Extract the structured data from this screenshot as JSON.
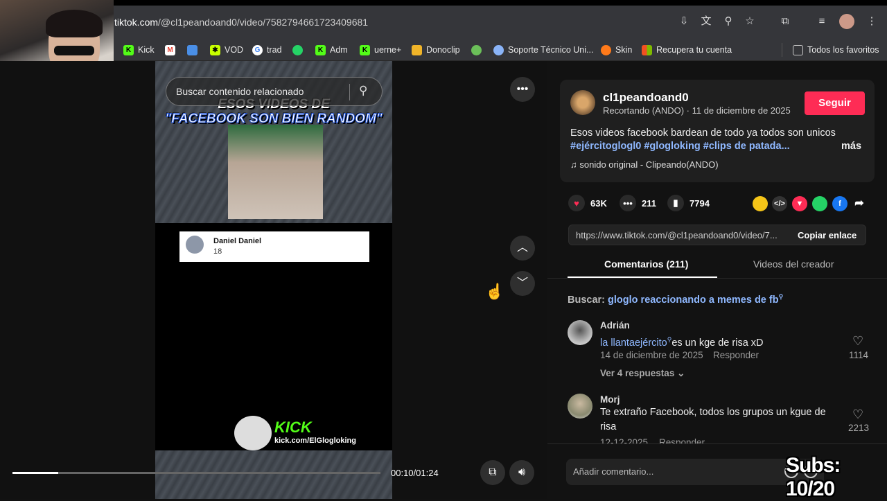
{
  "browser": {
    "url_host": "tiktok.com",
    "url_path": "/@cl1peandoand0/video/7582794661723409681",
    "bookmarks": [
      {
        "label": "Kick",
        "icon": "kick-icon",
        "color": "#53fc18"
      },
      {
        "label": "",
        "icon": "gmail-icon",
        "color": "#ea4335"
      },
      {
        "label": "",
        "icon": "extension-icon",
        "color": "#4a8fe7"
      },
      {
        "label": "VOD",
        "icon": "vod-icon",
        "color": "#c8ff00"
      },
      {
        "label": "trad",
        "icon": "google-icon",
        "color": "#ffffff"
      },
      {
        "label": "",
        "icon": "whatsapp-icon",
        "color": "#25d366"
      },
      {
        "label": "Adm",
        "icon": "kick-icon",
        "color": "#53fc18"
      },
      {
        "label": "uerne+",
        "icon": "kick-icon",
        "color": "#53fc18"
      },
      {
        "label": "Donoclip",
        "icon": "donoclip-icon",
        "color": "#f0b429"
      },
      {
        "label": "",
        "icon": "site-icon",
        "color": "#6bbf59"
      },
      {
        "label": "Soporte Técnico Uni...",
        "icon": "globe-icon",
        "color": "#8ab4f8"
      },
      {
        "label": "Skin",
        "icon": "pumpkin-icon",
        "color": "#ff7a1a"
      },
      {
        "label": "Recupera tu cuenta",
        "icon": "microsoft-icon",
        "color": "#f25022"
      }
    ],
    "all_favorites": "Todos los favoritos"
  },
  "video": {
    "search_placeholder": "Buscar contenido relacionado",
    "caption_line1": "ESOS VIDEOS DE",
    "caption_line2": "\"FACEBOOK SON BIEN RANDOM\"",
    "fb_name": "Daniel Daniel",
    "fb_number": "18",
    "kick_text": "KICK",
    "kick_url": "kick.com/ElGlogloking",
    "time": "00:10/01:24",
    "progress": 0.124
  },
  "post": {
    "author": "cl1peandoand0",
    "author_sub": "Recortando (ANDO) · 11 de diciembre de 2025",
    "follow": "Seguir",
    "description": "Esos videos facebook bardean de todo ya todos son unicos",
    "tags": "#ejércitoglogl0 #glogloking #clips de patada...",
    "more": "más",
    "sound": "sonido original - Clipeando(ANDO)",
    "likes": "63K",
    "comments": "211",
    "saves": "7794",
    "link": "https://www.tiktok.com/@cl1peandoand0/video/7...",
    "copy_link": "Copiar enlace"
  },
  "tabs": {
    "comments": "Comentarios (211)",
    "creator_videos": "Videos del creador"
  },
  "search_suggest": {
    "label": "Buscar:",
    "query": "gloglo reaccionando a memes de fb"
  },
  "comments": [
    {
      "name": "Adrián",
      "mention": "la llantaejército",
      "text": "es un kge de risa xD",
      "date": "14 de diciembre de 2025",
      "reply": "Responder",
      "likes": "1114",
      "see_replies": "Ver 4 respuestas"
    },
    {
      "name": "Morj",
      "text": "Te extraño Facebook, todos los grupos un kgue de risa",
      "date": "12-12-2025",
      "reply": "Responder",
      "likes": "2213"
    }
  ],
  "comment_input": {
    "placeholder": "Añadir comentario..."
  },
  "overlay": {
    "subs": "Subs: 10/20"
  },
  "colors": {
    "accent": "#fe2c55",
    "link": "#8fb8ff"
  }
}
